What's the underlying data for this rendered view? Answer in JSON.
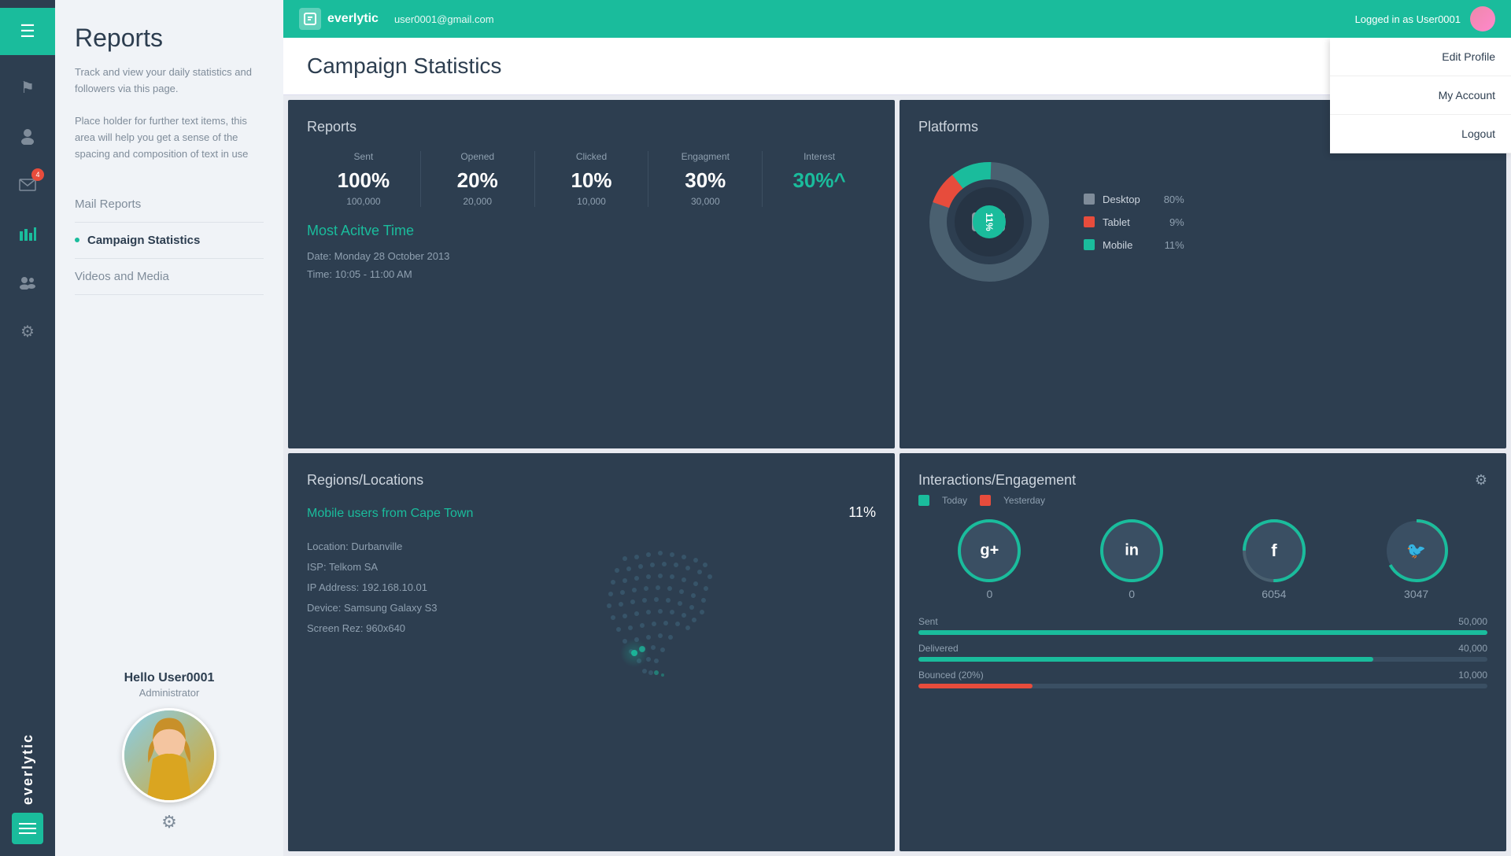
{
  "app": {
    "name": "everlytic",
    "logo_icon": "≡",
    "user_email": "user0001@gmail.com",
    "logged_in_as": "Logged in as User0001"
  },
  "dropdown": {
    "items": [
      "Edit Profile",
      "My Account",
      "Logout"
    ]
  },
  "icon_bar": {
    "icons": [
      {
        "name": "alert-icon",
        "symbol": "!",
        "active": false
      },
      {
        "name": "user-icon",
        "symbol": "👤",
        "active": false
      },
      {
        "name": "mail-icon",
        "symbol": "✉",
        "active": false,
        "badge": "4"
      },
      {
        "name": "chart-icon",
        "symbol": "▊",
        "active": true
      },
      {
        "name": "group-icon",
        "symbol": "👥",
        "active": false
      },
      {
        "name": "settings-icon",
        "symbol": "⚙",
        "active": false
      }
    ]
  },
  "sidebar": {
    "title": "Reports",
    "description": "Track and view your daily statistics and followers via this page.\n\nPlace holder for further text items, this area will help you get a sense of the spacing and composition of text in use",
    "nav_items": [
      {
        "label": "Mail Reports",
        "active": false
      },
      {
        "label": "Campaign Statistics",
        "active": true
      },
      {
        "label": "Videos and Media",
        "active": false
      }
    ],
    "user": {
      "greeting": "Hello User0001",
      "role": "Administrator"
    }
  },
  "page": {
    "title": "Campaign Statistics"
  },
  "reports_card": {
    "title": "Reports",
    "stats": [
      {
        "label": "Sent",
        "value": "100%",
        "sub": "100,000"
      },
      {
        "label": "Opened",
        "value": "20%",
        "sub": "20,000"
      },
      {
        "label": "Clicked",
        "value": "10%",
        "sub": "10,000"
      },
      {
        "label": "Engagment",
        "value": "30%",
        "sub": "30,000"
      },
      {
        "label": "Interest",
        "value": "30%^",
        "green": true,
        "sub": ""
      }
    ],
    "most_active_title": "Most Acitve Time",
    "date_label": "Date: Monday 28 October 2013",
    "time_label": "Time: 10:05 - 11:00 AM"
  },
  "platforms_card": {
    "title": "Platforms",
    "center_label": "11%",
    "legend": [
      {
        "label": "Desktop",
        "pct": "80%",
        "color": "#7f8c9a"
      },
      {
        "label": "Tablet",
        "pct": "9%",
        "color": "#e74c3c"
      },
      {
        "label": "Mobile",
        "pct": "11%",
        "color": "#1abc9c"
      }
    ],
    "donut_segments": [
      {
        "pct": 80,
        "color": "#4a6070"
      },
      {
        "pct": 9,
        "color": "#e74c3c"
      },
      {
        "pct": 11,
        "color": "#1abc9c"
      }
    ]
  },
  "regions_card": {
    "title": "Regions/Locations",
    "subtitle": "Mobile users from Cape Town",
    "percentage": "11%",
    "details": [
      "Location: Durbanville",
      "ISP: Telkom SA",
      "IP Address: 192.168.10.01",
      "Device: Samsung Galaxy S3",
      "Screen Rez: 960x640"
    ]
  },
  "interactions_card": {
    "title": "Interactions/Engagement",
    "legend": [
      {
        "label": "Today",
        "color": "#1abc9c"
      },
      {
        "label": "Yesterday",
        "color": "#e74c3c"
      }
    ],
    "social": [
      {
        "name": "google-plus",
        "letter": "g+",
        "value": "0"
      },
      {
        "name": "linkedin",
        "letter": "in",
        "value": "0"
      },
      {
        "name": "facebook",
        "letter": "f",
        "value": "6054"
      },
      {
        "name": "twitter",
        "letter": "🐦",
        "value": "3047"
      }
    ],
    "progress_bars": [
      {
        "label": "Sent",
        "value": "50,000",
        "fill": 100,
        "color": "#1abc9c"
      },
      {
        "label": "Delivered",
        "value": "40,000",
        "fill": 80,
        "color": "#1abc9c"
      },
      {
        "label": "Bounced (20%)",
        "value": "10,000",
        "fill": 20,
        "color": "#e74c3c"
      }
    ]
  }
}
